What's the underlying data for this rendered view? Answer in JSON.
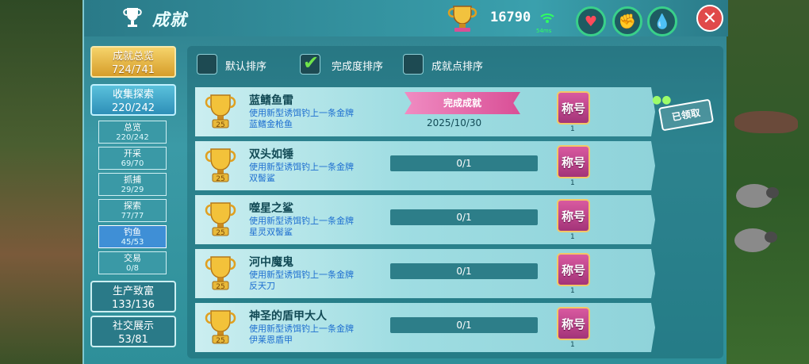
{
  "header": {
    "title": "成就",
    "score": "16790",
    "ping": "54ms",
    "status_icons": [
      "heart-icon",
      "flex-arm-icon",
      "water-drop-icon"
    ],
    "close_label": "✕"
  },
  "sidebar": {
    "overview": {
      "label": "成就总览",
      "count": "724/741"
    },
    "collect": {
      "label": "收集探索",
      "count": "220/242"
    },
    "sub_items": [
      {
        "label": "总览",
        "count": "220/242"
      },
      {
        "label": "开采",
        "count": "69/70"
      },
      {
        "label": "抓捕",
        "count": "29/29"
      },
      {
        "label": "探索",
        "count": "77/77"
      },
      {
        "label": "钓鱼",
        "count": "45/53"
      },
      {
        "label": "交易",
        "count": "0/8"
      }
    ],
    "production": {
      "label": "生产致富",
      "count": "133/136"
    },
    "social": {
      "label": "社交展示",
      "count": "53/81"
    }
  },
  "sort_options": {
    "default": "默认排序",
    "completion": "完成度排序",
    "points": "成就点排序"
  },
  "achievements": [
    {
      "name": "蓝鳍鱼雷",
      "desc1": "使用新型诱饵钓上一条金牌",
      "desc2": "蓝鳍金枪鱼",
      "points": "25",
      "status": "完成成就",
      "date": "2025/10/30",
      "reward": "称号",
      "reward_count": "1"
    },
    {
      "name": "双头如锤",
      "desc1": "使用新型诱饵钓上一条金牌",
      "desc2": "双髻鲨",
      "points": "25",
      "progress": "0/1",
      "reward": "称号",
      "reward_count": "1"
    },
    {
      "name": "噬星之鲨",
      "desc1": "使用新型诱饵钓上一条金牌",
      "desc2": "星灵双髻鲨",
      "points": "25",
      "progress": "0/1",
      "reward": "称号",
      "reward_count": "1"
    },
    {
      "name": "河中魔鬼",
      "desc1": "使用新型诱饵钓上一条金牌",
      "desc2": "反天刀",
      "points": "25",
      "progress": "0/1",
      "reward": "称号",
      "reward_count": "1"
    },
    {
      "name": "神圣的盾甲大人",
      "desc1": "使用新型诱饵钓上一条金牌",
      "desc2": "伊莱恩盾甲",
      "points": "25",
      "progress": "0/1",
      "reward": "称号",
      "reward_count": "1"
    }
  ],
  "claimed_stamp": "已领取",
  "colors": {
    "accent": "#3aa0ad",
    "gold": "#d69d2a",
    "badge": "#d95aa0"
  }
}
